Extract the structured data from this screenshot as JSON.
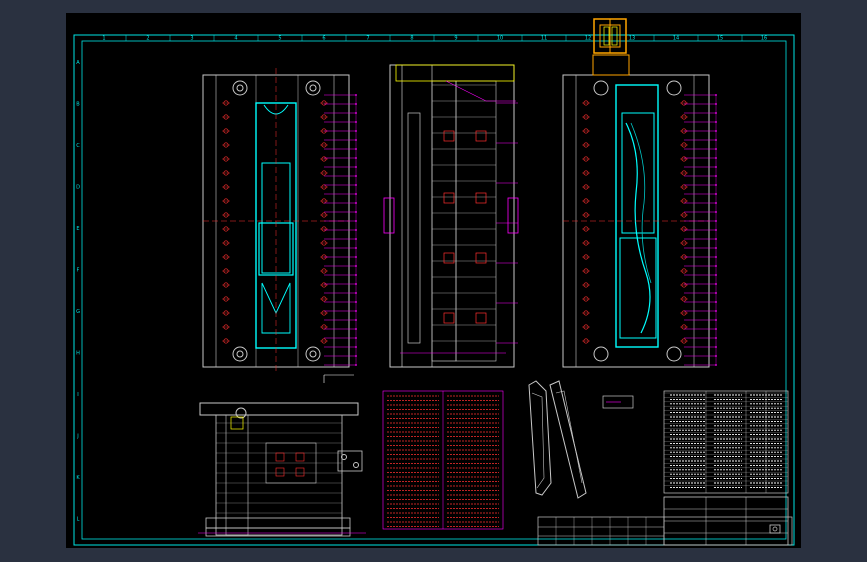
{
  "viewer": {
    "background_color": "#2a3140",
    "canvas_color": "#000000"
  },
  "drawing": {
    "border_color": "#00e5e5",
    "mold_outline_color": "#c8c8c8",
    "cavity_color": "#00ffff",
    "dimension_color": "#ff00ff",
    "detail_color": "#ff3030",
    "text_color": "#ffffff",
    "accent_color": "#ffa500",
    "zone_numbers_top": [
      "1",
      "2",
      "3",
      "4",
      "5",
      "6",
      "7",
      "8",
      "9",
      "10",
      "11",
      "12",
      "13",
      "14",
      "15",
      "16"
    ],
    "zone_letters_side": [
      "A",
      "B",
      "C",
      "D",
      "E",
      "F",
      "G",
      "H",
      "I",
      "J",
      "K",
      "L"
    ]
  }
}
